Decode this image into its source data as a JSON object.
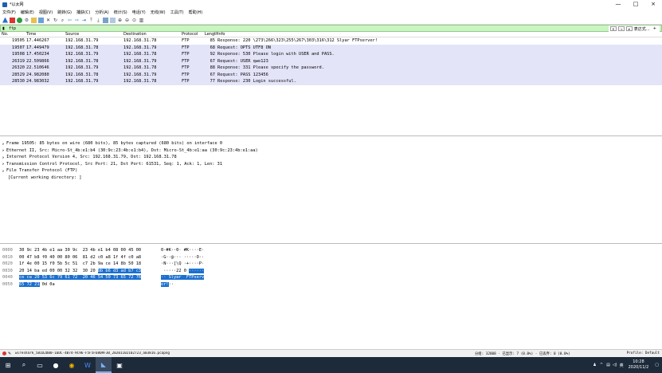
{
  "window": {
    "title": "*以太网",
    "controls": [
      "—",
      "□",
      "×"
    ]
  },
  "menu": [
    "文件(F)",
    "编辑(E)",
    "视图(V)",
    "跳转(G)",
    "捕获(C)",
    "分析(A)",
    "统计(S)",
    "电话(Y)",
    "无线(W)",
    "工具(T)",
    "帮助(H)"
  ],
  "filter": {
    "value": "ftp",
    "expression_label": "表达式…",
    "plus": "+"
  },
  "columns": {
    "no": "No.",
    "time": "Time",
    "source": "Source",
    "destination": "Destination",
    "protocol": "Protocol",
    "length": "Length",
    "info": "Info"
  },
  "packets": [
    {
      "no": "19505",
      "time": "17.446267",
      "src": "192.168.31.79",
      "dst": "192.168.31.78",
      "proto": "FTP",
      "len": "85",
      "info": "Response: 220 \\273\\266\\323\\255\\267\\303\\316\\312 Slyar FTPserver!"
    },
    {
      "no": "19507",
      "time": "17.449479",
      "src": "192.168.31.78",
      "dst": "192.168.31.79",
      "proto": "FTP",
      "len": "68",
      "info": "Request: OPTS UTF8 ON"
    },
    {
      "no": "19508",
      "time": "17.450234",
      "src": "192.168.31.79",
      "dst": "192.168.31.78",
      "proto": "FTP",
      "len": "92",
      "info": "Response: 530 Please login with USER and PASS."
    },
    {
      "no": "26319",
      "time": "22.509866",
      "src": "192.168.31.78",
      "dst": "192.168.31.79",
      "proto": "FTP",
      "len": "67",
      "info": "Request: USER qwe123"
    },
    {
      "no": "26320",
      "time": "22.510646",
      "src": "192.168.31.79",
      "dst": "192.168.31.78",
      "proto": "FTP",
      "len": "88",
      "info": "Response: 331 Please specify the password."
    },
    {
      "no": "28529",
      "time": "24.982080",
      "src": "192.168.31.78",
      "dst": "192.168.31.79",
      "proto": "FTP",
      "len": "67",
      "info": "Request: PASS 123456"
    },
    {
      "no": "28530",
      "time": "24.983032",
      "src": "192.168.31.79",
      "dst": "192.168.31.78",
      "proto": "FTP",
      "len": "77",
      "info": "Response: 230 Login successful."
    }
  ],
  "details": [
    {
      "text": "Frame 19505: 85 bytes on wire (680 bits), 85 bytes captured (680 bits) on interface 0",
      "arrow": ">"
    },
    {
      "text": "Ethernet II, Src: Micro-St_4b:e1:b4 (30:9c:23:4b:e1:b4), Dst: Micro-St_4b:e1:aa (30:9c:23:4b:e1:aa)",
      "arrow": ">"
    },
    {
      "text": "Internet Protocol Version 4, Src: 192.168.31.79, Dst: 192.168.31.78",
      "arrow": ">"
    },
    {
      "text": "Transmission Control Protocol, Src Port: 21, Dst Port: 61531, Seq: 1, Ack: 1, Len: 31",
      "arrow": ">"
    },
    {
      "text": "File Transfer Protocol (FTP)",
      "arrow": ">"
    },
    {
      "text": "[Current working directory: ]",
      "arrow": ""
    }
  ],
  "bytes": [
    {
      "off": "0000",
      "hex": [
        "30 9c 23 4b e1 aa 30 9c  23 4b e1 b4 08 00 45 00"
      ],
      "ascii": [
        "0·#K··0· #K····E·"
      ]
    },
    {
      "off": "0010",
      "hex": [
        "00 47 b8 f0 40 00 80 06  81 d2 c0 a8 1f 4f c0 a8"
      ],
      "ascii": [
        "·G··@··· ·····O··"
      ]
    },
    {
      "off": "0020",
      "hex": [
        "1f 4e 00 15 f0 5b 5c 51  c7 2b 9a ce 14 8b 50 18"
      ],
      "ascii": [
        "·N···[\\Q ·+····P·"
      ]
    },
    {
      "off": "0030",
      "hex": [
        "20 14 ba ed 00 00 32 32  30 20 ",
        "bb b6 d3 ad b7 c3"
      ],
      "ascii": [
        " ·····22 0 ",
        "······"
      ]
    },
    {
      "off": "0040",
      "hex": [
        "",
        "ce ca 20 53 6c 79 61 72  20 46 54 50 73 65 72 76"
      ],
      "ascii": [
        "",
        "·· Slyar  FTPserv"
      ]
    },
    {
      "off": "0050",
      "hex": [
        "",
        "65 72 21",
        " 0d 0a"
      ],
      "ascii": [
        "",
        "er!",
        "··"
      ]
    }
  ],
  "status": {
    "file": "wireshark_5B1D2DB0-16DC-4B74-9C96-F5F5F6809F30_20201102102723_a03816.pcapng",
    "stats": "分组: 32808 · 已显示: 7 (0.0%) · 已丢弃: 0 (0.0%)",
    "profile": "Profile: Default"
  },
  "taskbar": {
    "time": "10:28",
    "date": "2020/11/2",
    "lang": "英"
  }
}
